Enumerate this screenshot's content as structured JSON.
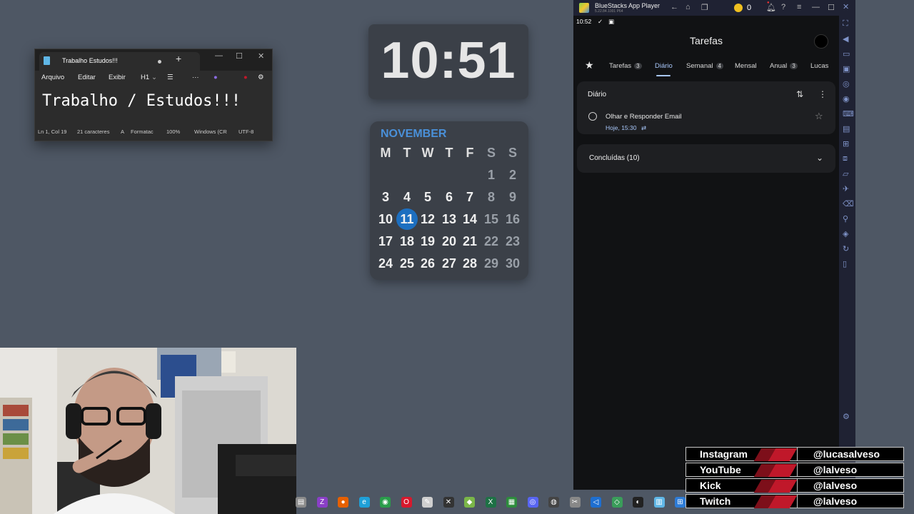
{
  "notepad": {
    "tab_title": "Trabalho  Estudos!!!",
    "menu": [
      "Arquivo",
      "Editar",
      "Exibir",
      "H1"
    ],
    "content": "Trabalho / Estudos!!!",
    "status": [
      "Ln 1, Col 19",
      "21 caracteres",
      "Formatac",
      "100%",
      "Windows (CR",
      "UTF-8"
    ]
  },
  "clock": {
    "time": "10:51"
  },
  "calendar": {
    "month": "NOVEMBER",
    "weekdays": [
      "M",
      "T",
      "W",
      "T",
      "F",
      "S",
      "S"
    ],
    "rows": [
      [
        "",
        "",
        "",
        "",
        "",
        "1",
        "2"
      ],
      [
        "3",
        "4",
        "5",
        "6",
        "7",
        "8",
        "9"
      ],
      [
        "10",
        "11",
        "12",
        "13",
        "14",
        "15",
        "16"
      ],
      [
        "17",
        "18",
        "19",
        "20",
        "21",
        "22",
        "23"
      ],
      [
        "24",
        "25",
        "26",
        "27",
        "28",
        "29",
        "30"
      ]
    ],
    "today": "11"
  },
  "bluestacks": {
    "title": "BlueStacks App Player",
    "version": "5.22.84.1001 P64",
    "coins": "0",
    "status_time": "10:52",
    "app_title": "Tarefas",
    "tabs": [
      {
        "label": "Tarefas",
        "badge": "3"
      },
      {
        "label": "Diário",
        "badge": ""
      },
      {
        "label": "Semanal",
        "badge": "4"
      },
      {
        "label": "Mensal",
        "badge": ""
      },
      {
        "label": "Anual",
        "badge": "3"
      },
      {
        "label": "Lucas",
        "badge": ""
      }
    ],
    "list_title": "Diário",
    "task": {
      "text": "Olhar e Responder Email",
      "due": "Hoje, 15:30"
    },
    "completed": "Concluídas (10)"
  },
  "social": [
    {
      "name": "Instagram",
      "handle": "@lucasalveso"
    },
    {
      "name": "YouTube",
      "handle": "@lalveso"
    },
    {
      "name": "Kick",
      "handle": "@lalveso"
    },
    {
      "name": "Twitch",
      "handle": "@lalveso"
    }
  ],
  "colors": {
    "desktop": "#4e5764",
    "accent_blue": "#a8c7fa",
    "calendar_today": "#1d6fc0",
    "social_red": "#c0182a"
  }
}
